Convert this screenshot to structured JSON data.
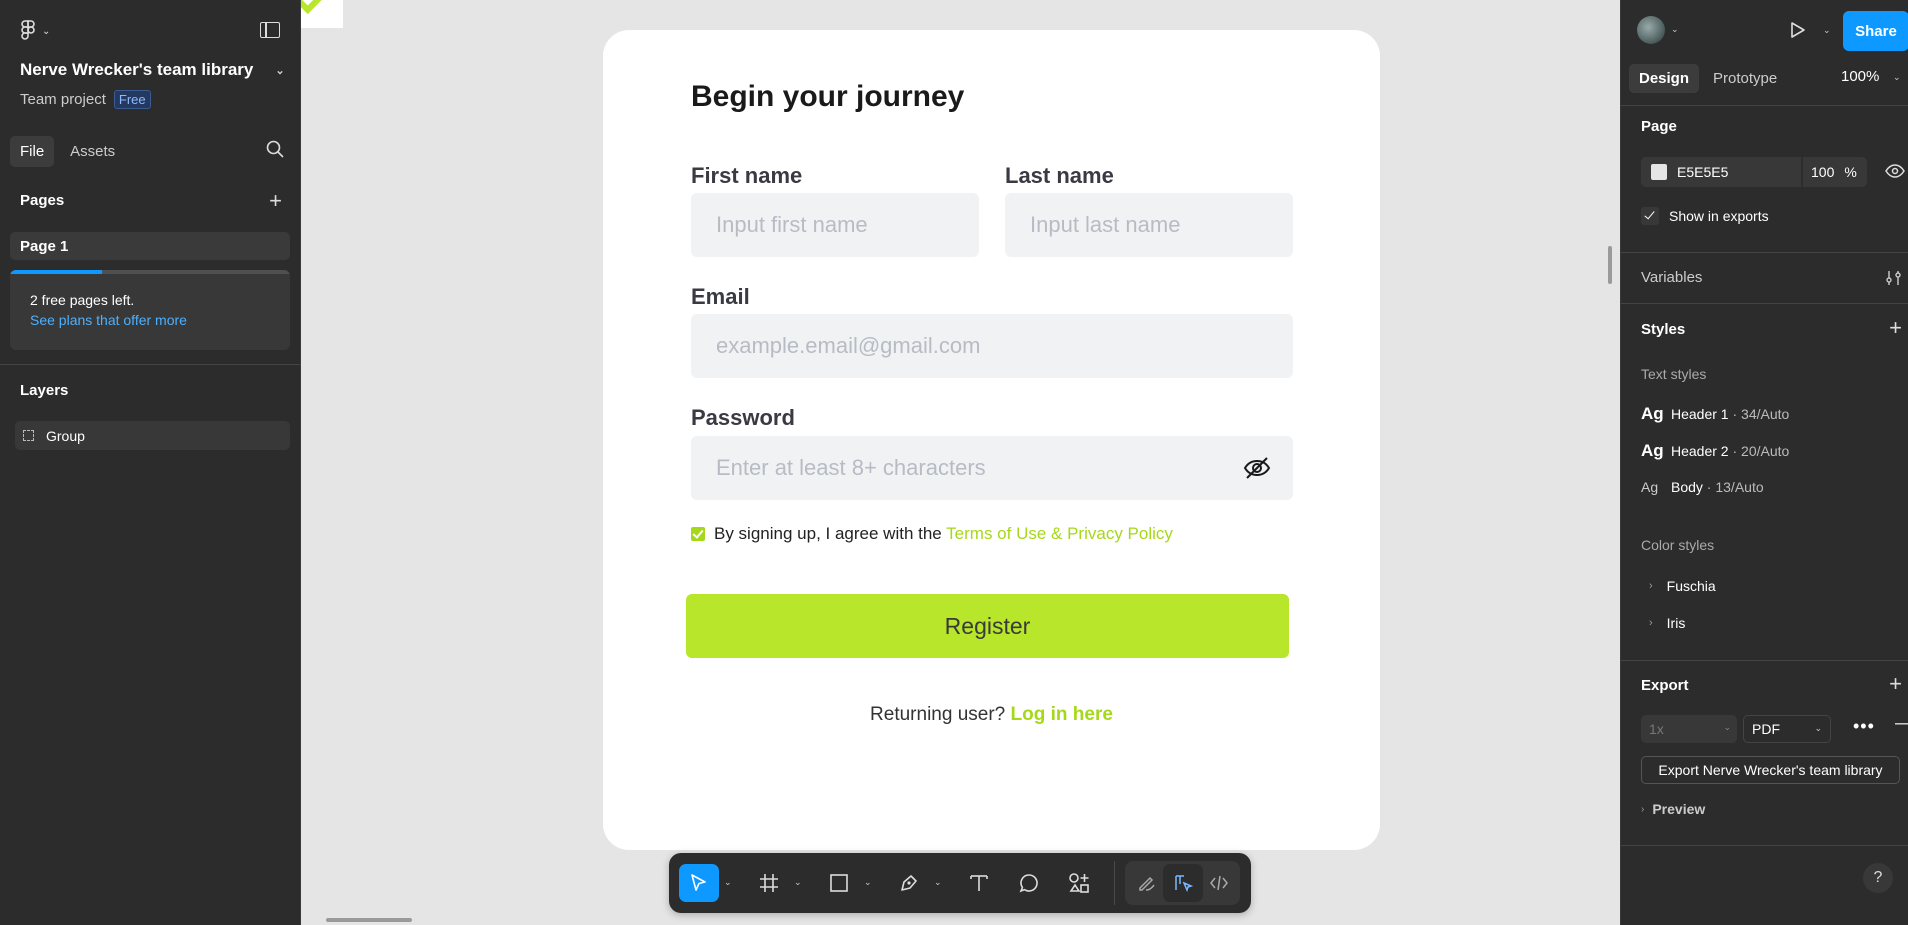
{
  "left_panel": {
    "team_name": "Nerve Wrecker's team library",
    "project_label": "Team project",
    "plan_badge": "Free",
    "tabs": [
      {
        "label": "File"
      },
      {
        "label": "Assets"
      }
    ],
    "pages_title": "Pages",
    "pages": [
      {
        "label": "Page 1"
      }
    ],
    "pages_left": {
      "text": "2 free pages left.",
      "link": "See plans that offer more",
      "progress": 0.33
    },
    "layers_title": "Layers",
    "layers": [
      {
        "label": "Group"
      }
    ]
  },
  "canvas": {
    "form": {
      "title": "Begin your journey",
      "first_name_label": "First name",
      "first_name_placeholder": "Input first name",
      "last_name_label": "Last name",
      "last_name_placeholder": "Input last name",
      "email_label": "Email",
      "email_placeholder": "example.email@gmail.com",
      "password_label": "Password",
      "password_placeholder": "Enter at least 8+ characters",
      "agree_text": "By signing up, I agree with the",
      "terms_link": "Terms of Use & Privacy Policy",
      "register_label": "Register",
      "returning_text": "Returning user?",
      "login_link": "Log in here",
      "accent_color": "#b7e62a"
    },
    "toolbar": {
      "tools": [
        "move-tool",
        "frame-tool",
        "rectangle-tool",
        "pen-tool",
        "text-tool",
        "comment-tool",
        "actions-tool",
        "draw-mode",
        "design-mode",
        "dev-mode"
      ],
      "active_tool": "move-tool"
    }
  },
  "right_panel": {
    "share_label": "Share",
    "tabs": [
      {
        "label": "Design"
      },
      {
        "label": "Prototype"
      }
    ],
    "zoom": "100%",
    "page_section": {
      "title": "Page",
      "background_hex": "E5E5E5",
      "opacity": "100",
      "opacity_unit": "%",
      "show_in_exports": "Show in exports"
    },
    "variables_title": "Variables",
    "styles": {
      "title": "Styles",
      "text_styles_title": "Text styles",
      "text_styles": [
        {
          "glyph": "Ag",
          "name": "Header 1",
          "meta": " · 34/Auto"
        },
        {
          "glyph": "Ag",
          "name": "Header 2",
          "meta": " · 20/Auto"
        },
        {
          "glyph": "Ag",
          "name": "Body",
          "meta": " · 13/Auto"
        }
      ],
      "color_styles_title": "Color styles",
      "color_styles": [
        {
          "name": "Fuschia"
        },
        {
          "name": "Iris"
        }
      ]
    },
    "export": {
      "title": "Export",
      "scale": "1x",
      "format": "PDF",
      "button_label": "Export Nerve Wrecker's team library",
      "preview_label": "Preview"
    },
    "help_label": "?"
  }
}
